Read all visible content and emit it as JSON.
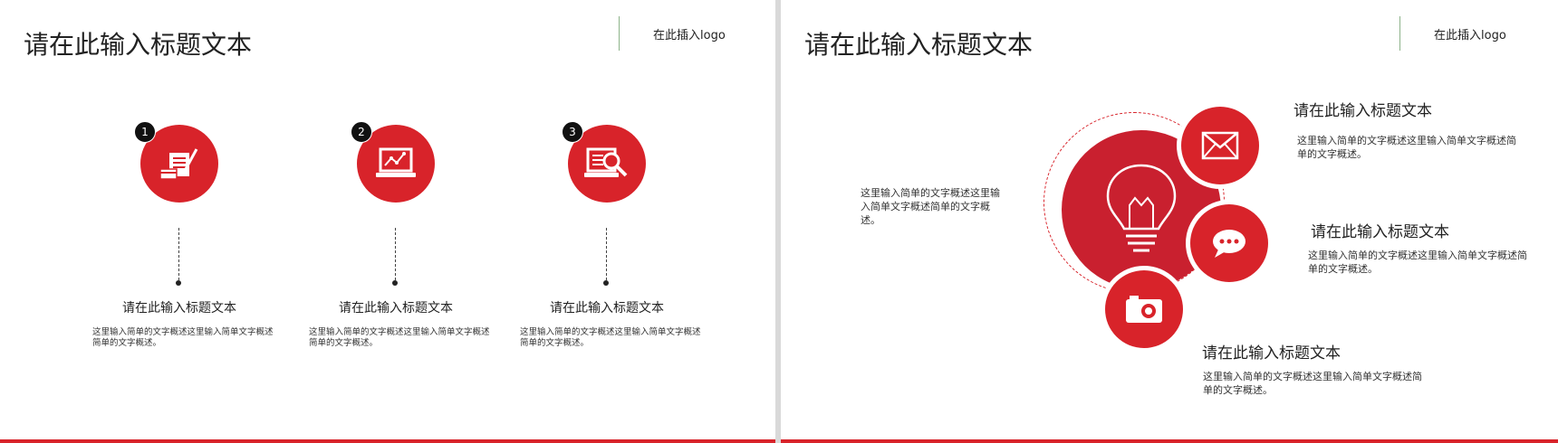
{
  "slide1": {
    "title": "请在此输入标题文本",
    "logo": "在此插入logo",
    "steps": [
      {
        "number": "1",
        "icon": "document-pen-icon",
        "title": "请在此输入标题文本",
        "desc": "这里输入简单的文字概述这里输入简单文字概述简单的文字概述。"
      },
      {
        "number": "2",
        "icon": "laptop-chart-icon",
        "title": "请在此输入标题文本",
        "desc": "这里输入简单的文字概述这里输入简单文字概述简单的文字概述。"
      },
      {
        "number": "3",
        "icon": "laptop-search-icon",
        "title": "请在此输入标题文本",
        "desc": "这里输入简单的文字概述这里输入简单文字概述简单的文字概述。"
      }
    ]
  },
  "slide2": {
    "title": "请在此输入标题文本",
    "logo": "在此插入logo",
    "left_desc": "这里输入简单的文字概述这里输入简单文字概述简单的文字概述。",
    "center_icon": "lightbulb-icon",
    "items": [
      {
        "icon": "envelope-icon",
        "title": "请在此输入标题文本",
        "desc": "这里输入简单的文字概述这里输入简单文字概述简单的文字概述。"
      },
      {
        "icon": "chat-bubble-icon",
        "title": "请在此输入标题文本",
        "desc": "这里输入简单的文字概述这里输入简单文字概述简单的文字概述。"
      },
      {
        "icon": "camera-icon",
        "title": "请在此输入标题文本",
        "desc": "这里输入简单的文字概述这里输入简单文字概述简单的文字概述。"
      }
    ]
  },
  "colors": {
    "accent": "#d8232a",
    "center": "#c9202f"
  }
}
